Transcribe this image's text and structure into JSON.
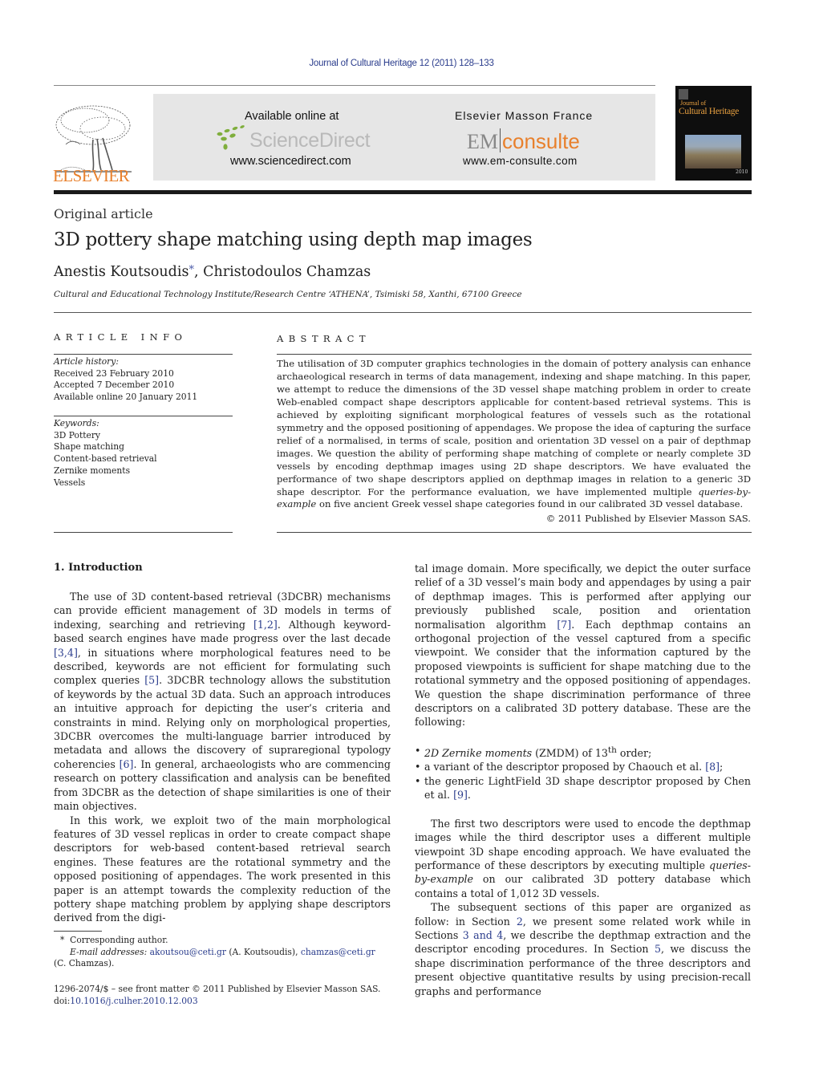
{
  "journal_ref": "Journal of Cultural Heritage 12 (2011) 128–133",
  "banner": {
    "publisher_logo_text": "ELSEVIER",
    "sciencedirect": {
      "available_label": "Available online at",
      "brand": "ScienceDirect",
      "url": "www.sciencedirect.com"
    },
    "emconsulte": {
      "label": "Elsevier Masson France",
      "brand_em": "EM",
      "brand_consulte": "consulte",
      "url": "www.em-consulte.com"
    },
    "cover": {
      "line1": "Journal of",
      "line2": "Cultural Heritage",
      "year": "2010"
    },
    "colors": {
      "elsevier_orange": "#e8802c",
      "link_blue": "#2a3c8c",
      "banner_gray": "#e6e6e6"
    }
  },
  "article_type": "Original article",
  "title": "3D pottery shape matching using depth map images",
  "authors": {
    "first": "Anestis Koutsoudis",
    "star": "*",
    "rest": ", Christodoulos Chamzas"
  },
  "affiliation": "Cultural and Educational Technology Institute/Research Centre ‘ATHENA’, Tsimiski 58, Xanthi, 67100 Greece",
  "article_info": {
    "heading": "ARTICLE INFO",
    "history_label": "Article history:",
    "history": [
      "Received 23 February 2010",
      "Accepted 7 December 2010",
      "Available online 20 January 2011"
    ],
    "keywords_label": "Keywords:",
    "keywords": [
      "3D Pottery",
      "Shape matching",
      "Content-based retrieval",
      "Zernike moments",
      "Vessels"
    ]
  },
  "abstract": {
    "heading": "ABSTRACT",
    "text_before_italic": "The utilisation of 3D computer graphics technologies in the domain of pottery analysis can enhance archaeological research in terms of data management, indexing and shape matching. In this paper, we attempt to reduce the dimensions of the 3D vessel shape matching problem in order to create Web-enabled compact shape descriptors applicable for content-based retrieval systems. This is achieved by exploiting significant morphological features of vessels such as the rotational symmetry and the opposed positioning of appendages. We propose the idea of capturing the surface relief of a normalised, in terms of scale, position and orientation 3D vessel on a pair of depthmap images. We question the ability of performing shape matching of complete or nearly complete 3D vessels by encoding depthmap images using 2D shape descriptors. We have evaluated the performance of two shape descriptors applied on depthmap images in relation to a generic 3D shape descriptor. For the performance evaluation, we have implemented multiple ",
    "italic": "queries-by-example",
    "text_after_italic": " on five ancient Greek vessel shape categories found in our calibrated 3D vessel database.",
    "copyright": "© 2011 Published by Elsevier Masson SAS."
  },
  "section1": {
    "heading": "1.  Introduction",
    "p1": {
      "a": "The use of 3D content-based retrieval (3DCBR) mechanisms can provide efficient management of 3D models in terms of indexing, searching and retrieving ",
      "ref1": "[1,2]",
      "b": ". Although keyword-based search engines have made progress over the last decade ",
      "ref2": "[3,4]",
      "c": ", in situations where morphological features need to be described, keywords are not efficient for formulating such complex queries ",
      "ref3": "[5]",
      "d": ". 3DCBR technology allows the substitution of keywords by the actual 3D data. Such an approach introduces an intuitive approach for depicting the user’s criteria and constraints in mind. Relying only on morphological properties, 3DCBR overcomes the multi-language barrier introduced by metadata and allows the discovery of supraregional typology coherencies ",
      "ref4": "[6]",
      "e": ". In general, archaeologists who are commencing research on pottery classification and analysis can be benefited from 3DCBR as the detection of shape similarities is one of their main objectives."
    },
    "p2": {
      "a": "In this work, we exploit two of the main morphological features of 3D vessel replicas in order to create compact shape descriptors for web-based content-based retrieval search engines. These features are the rotational symmetry and the opposed positioning of appendages. The work presented in this paper is an attempt towards the complexity reduction of the pottery shape matching problem by applying shape descriptors derived from the digital image domain. More specifically, we depict the outer surface relief of a 3D vessel’s main body and appendages by using a pair of depthmap images. This is performed after applying our previously published scale, position and orientation normalisation algorithm ",
      "ref1": "[7]",
      "b": ". Each depthmap contains an orthogonal projection of the vessel captured from a specific viewpoint. We consider that the information captured by the proposed viewpoints is sufficient for shape matching due to the rotational symmetry and the opposed positioning of appendages. We question the shape discrimination performance of three descriptors on a calibrated 3D pottery database. These are the following:"
    },
    "bullets": [
      {
        "italic": "2D Zernike moments",
        "text": " (ZMDM) of 13",
        "sup": "th",
        "tail": " order;",
        "ref": ""
      },
      {
        "italic": "",
        "text": "a variant of the descriptor proposed by Chaouch et al. ",
        "sup": "",
        "tail": ";",
        "ref": "[8]"
      },
      {
        "italic": "",
        "text": "the generic LightField 3D shape descriptor proposed by Chen et al. ",
        "sup": "",
        "tail": ".",
        "ref": "[9]"
      }
    ],
    "p3": {
      "a": "The first two descriptors were used to encode the depthmap images while the third descriptor uses a different multiple viewpoint 3D shape encoding approach. We have evaluated the performance of these descriptors by executing multiple ",
      "italic": "queries-by-example",
      "b": " on our calibrated 3D pottery database which contains a total of 1,012 3D vessels."
    },
    "p4": {
      "a": "The subsequent sections of this paper are organized as follow: in Section ",
      "ref1": "2",
      "b": ", we present some related work while in Sections ",
      "ref2": "3 and 4",
      "c": ", we describe the depthmap extraction and the descriptor encoding procedures. In Section ",
      "ref3": "5",
      "d": ", we discuss the shape discrimination performance of the three descriptors and present objective quantitative results by using precision-recall graphs and performance"
    }
  },
  "footnotes": {
    "star": "*",
    "corresponding": "Corresponding author.",
    "email_label": "E-mail addresses:",
    "email1": "akoutsou@ceti.gr",
    "email1_name": " (A. Koutsoudis), ",
    "email2": "chamzas@ceti.gr",
    "email2_name": "(C. Chamzas).",
    "front_matter": "1296-2074/$ – see front matter © 2011 Published by Elsevier Masson SAS.",
    "doi_label": "doi:",
    "doi": "10.1016/j.culher.2010.12.003"
  }
}
